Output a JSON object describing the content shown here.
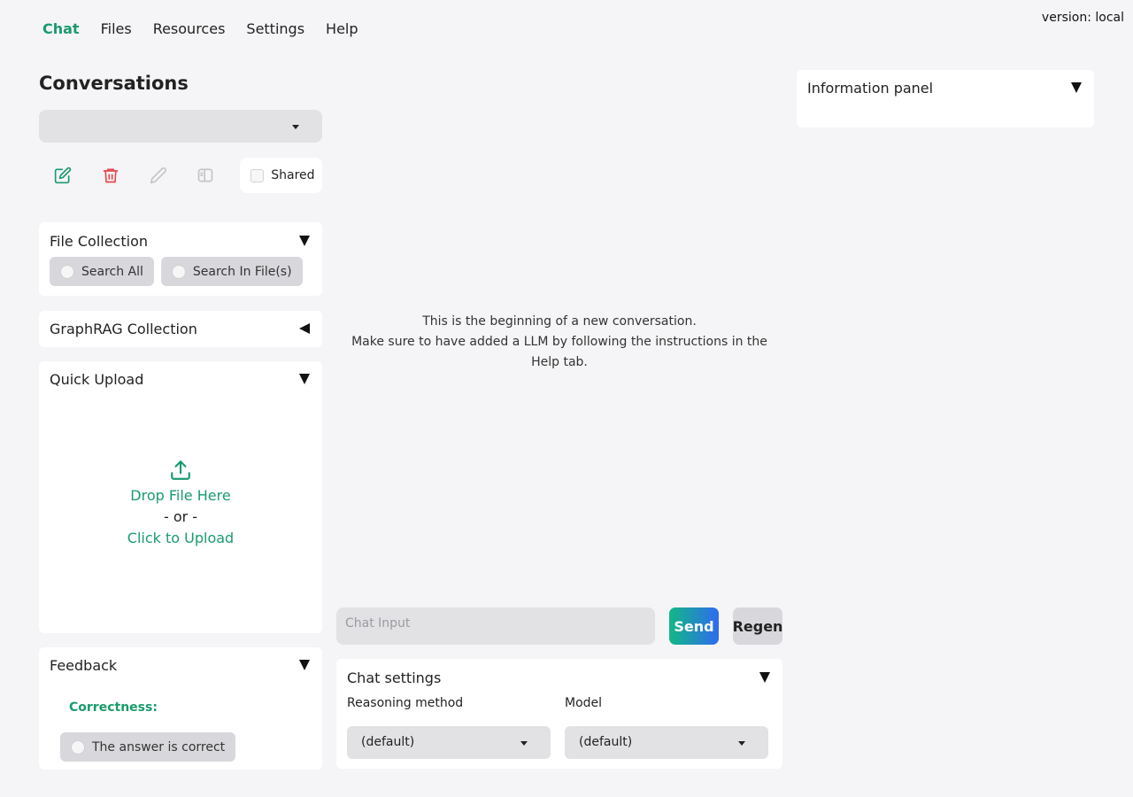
{
  "version": "version: local",
  "nav": {
    "tabs": [
      {
        "label": "Chat",
        "active": true
      },
      {
        "label": "Files"
      },
      {
        "label": "Resources"
      },
      {
        "label": "Settings"
      },
      {
        "label": "Help"
      }
    ]
  },
  "sidebar": {
    "title": "Conversations",
    "conversation_select_value": "",
    "toolbar": {
      "icons": [
        "new-conversation-icon",
        "delete-icon",
        "rename-icon",
        "toggle-panel-icon"
      ],
      "shared_label": "Shared"
    },
    "file_collection": {
      "title": "File Collection",
      "options": [
        "Search All",
        "Search In File(s)"
      ]
    },
    "graphrag": {
      "title": "GraphRAG Collection"
    },
    "quick_upload": {
      "title": "Quick Upload",
      "drop_text": "Drop File Here",
      "or_text": "- or -",
      "click_text": "Click to Upload"
    },
    "feedback": {
      "title": "Feedback",
      "correctness_label": "Correctness:",
      "option": "The answer is correct"
    }
  },
  "main": {
    "empty_line1": "This is the beginning of a new conversation.",
    "empty_line2": "Make sure to have added a LLM by following the instructions in the Help tab.",
    "chat_input_placeholder": "Chat Input",
    "send_label": "Send",
    "regen_label": "Regen",
    "chat_settings": {
      "title": "Chat settings",
      "reasoning_label": "Reasoning method",
      "reasoning_value": "(default)",
      "model_label": "Model",
      "model_value": "(default)"
    }
  },
  "info_panel": {
    "title": "Information panel"
  },
  "colors": {
    "accent": "#1a9b6d",
    "danger": "#e5484d"
  }
}
